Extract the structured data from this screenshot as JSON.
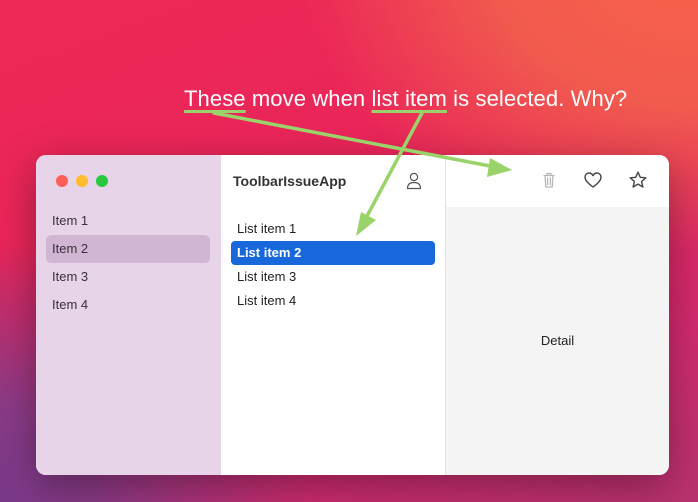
{
  "annotation": {
    "word1": "These",
    "mid1": " move when ",
    "word2": "list item",
    "mid2": " is selected. Why?"
  },
  "sidebar": {
    "items": [
      {
        "label": "Item 1"
      },
      {
        "label": "Item 2"
      },
      {
        "label": "Item 3"
      },
      {
        "label": "Item 4"
      }
    ],
    "selected_index": 1
  },
  "middle": {
    "title": "ToolbarIssueApp",
    "items": [
      {
        "label": "List item 1"
      },
      {
        "label": "List item 2"
      },
      {
        "label": "List item 3"
      },
      {
        "label": "List item 4"
      }
    ],
    "selected_index": 1
  },
  "detail": {
    "label": "Detail"
  },
  "icons": {
    "profile": "person-icon",
    "trash": "trash-icon",
    "favorite": "heart-icon",
    "star": "star-icon"
  },
  "colors": {
    "accent": "#1868dc",
    "annotation_arrow": "#9ad36a"
  }
}
